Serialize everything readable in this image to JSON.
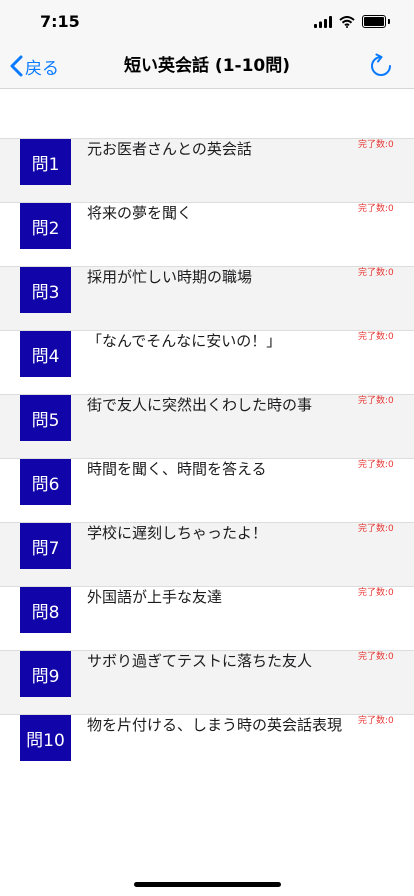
{
  "status_bar": {
    "time": "7:15"
  },
  "nav": {
    "back_label": "戻る",
    "title": "短い英会話 (1-10問)"
  },
  "count_label": "完了数:0",
  "questions": [
    {
      "badge": "問1",
      "title": "元お医者さんとの英会話"
    },
    {
      "badge": "問2",
      "title": "将来の夢を聞く"
    },
    {
      "badge": "問3",
      "title": "採用が忙しい時期の職場"
    },
    {
      "badge": "問4",
      "title": "「なんでそんなに安いの！」"
    },
    {
      "badge": "問5",
      "title": "街で友人に突然出くわした時の事"
    },
    {
      "badge": "問6",
      "title": "時間を聞く、時間を答える"
    },
    {
      "badge": "問7",
      "title": "学校に遅刻しちゃったよ！"
    },
    {
      "badge": "問8",
      "title": "外国語が上手な友達"
    },
    {
      "badge": "問9",
      "title": "サボり過ぎてテストに落ちた友人"
    },
    {
      "badge": "問10",
      "title": "物を片付ける、しまう時の英会話表現"
    }
  ],
  "colors": {
    "accent": "#0a7aff",
    "badge_bg": "#1104a8",
    "count": "#e53935"
  }
}
